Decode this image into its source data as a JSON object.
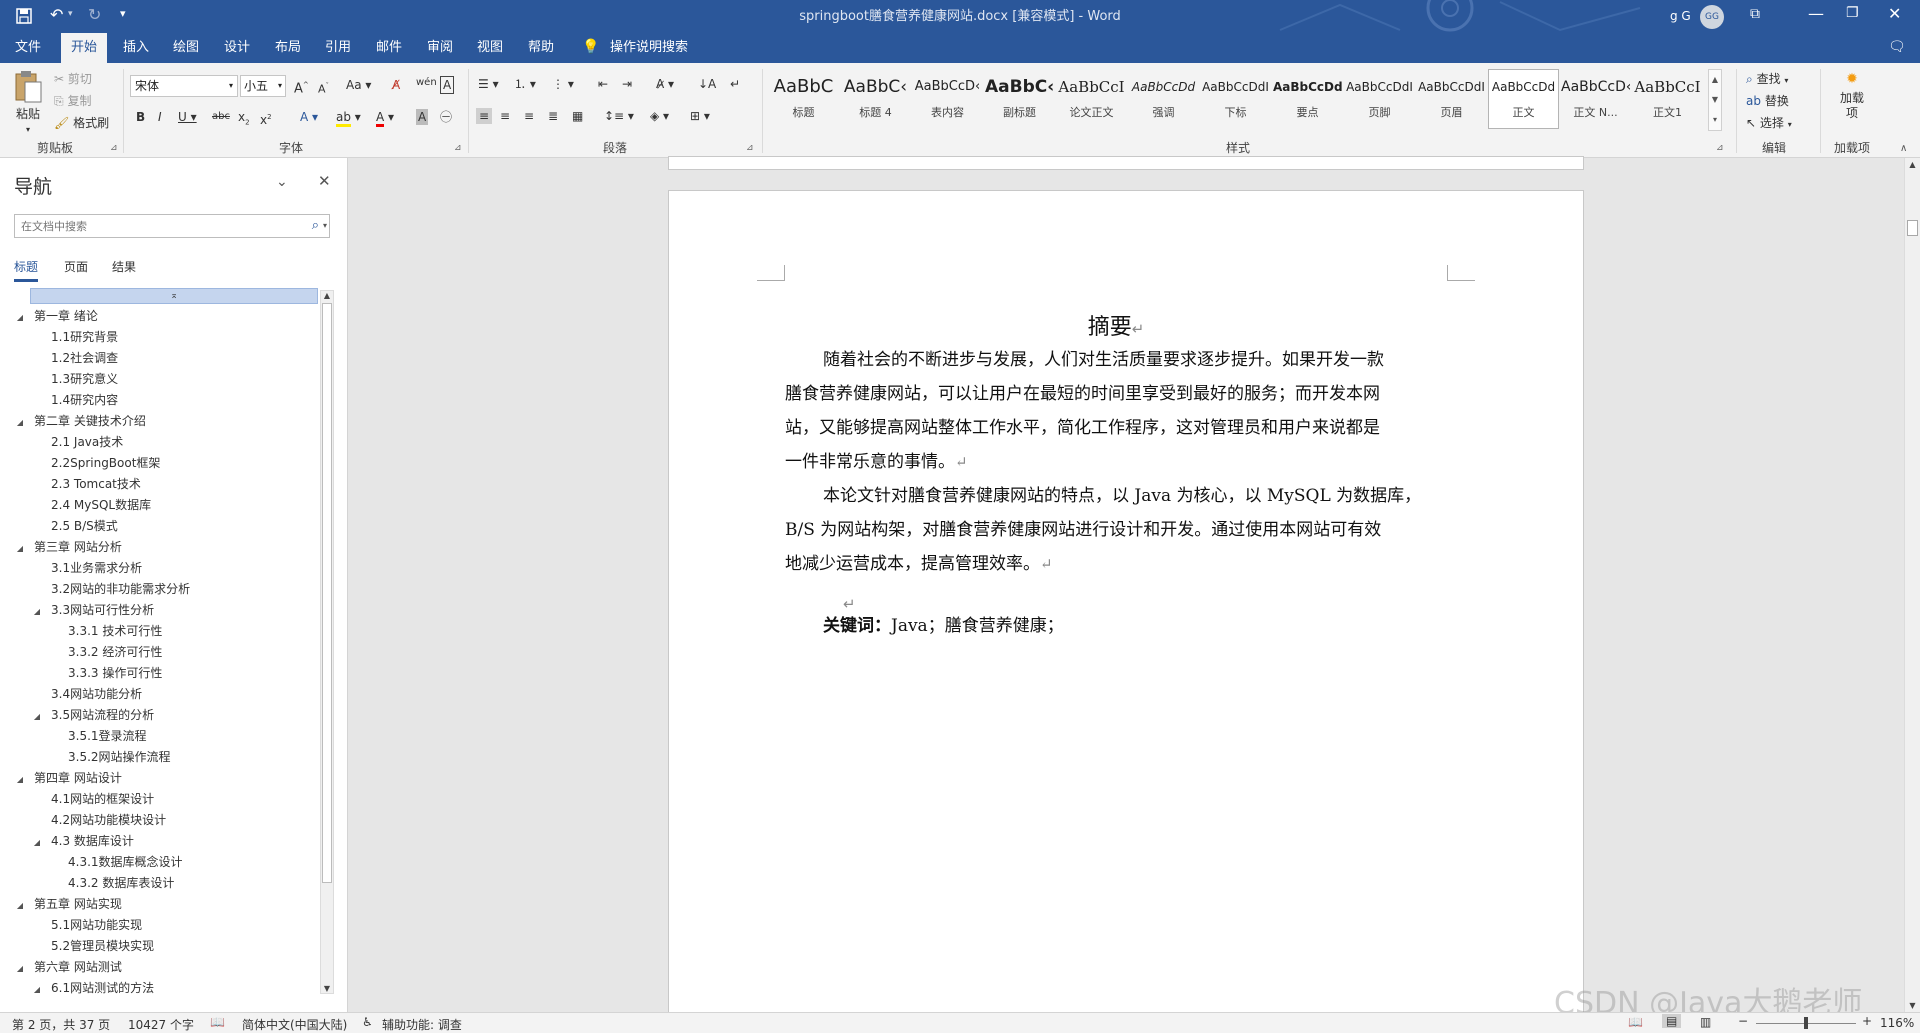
{
  "titlebar": {
    "title": "springboot膳食营养健康网站.docx [兼容模式] - Word",
    "user_name": "g G",
    "avatar_initials": "GG",
    "bg_color": "#2b579a"
  },
  "tabs": {
    "items": [
      "文件",
      "开始",
      "插入",
      "绘图",
      "设计",
      "布局",
      "引用",
      "邮件",
      "审阅",
      "视图",
      "帮助"
    ],
    "active": "开始",
    "tell_me": "操作说明搜索"
  },
  "ribbon": {
    "clipboard": {
      "paste": "粘贴",
      "cut": "剪切",
      "copy": "复制",
      "format_painter": "格式刷",
      "label": "剪贴板"
    },
    "font": {
      "name": "宋体",
      "size": "小五",
      "label": "字体"
    },
    "paragraph": {
      "label": "段落"
    },
    "styles": {
      "label": "样式",
      "items": [
        {
          "sample": "AaBbC",
          "name": "标题"
        },
        {
          "sample": "AaBbC‹",
          "name": "标题 4"
        },
        {
          "sample": "AaBbCcD‹",
          "name": "表内容"
        },
        {
          "sample": "AaBbC‹",
          "name": "副标题"
        },
        {
          "sample": "AaBbCcI",
          "name": "论文正文"
        },
        {
          "sample": "AaBbCcDd",
          "name": "强调"
        },
        {
          "sample": "AaBbCcDdI",
          "name": "下标"
        },
        {
          "sample": "AaBbCcDd",
          "name": "要点"
        },
        {
          "sample": "AaBbCcDdI",
          "name": "页脚"
        },
        {
          "sample": "AaBbCcDdI",
          "name": "页眉"
        },
        {
          "sample": "AaBbCcDd",
          "name": "正文"
        },
        {
          "sample": "AaBbCcD‹",
          "name": "正文 N..."
        },
        {
          "sample": "AaBbCcI",
          "name": "正文1"
        }
      ],
      "selected": "正文"
    },
    "editing": {
      "find": "查找",
      "replace": "替换",
      "select": "选择",
      "label": "编辑"
    },
    "addins": {
      "button": "加载项",
      "label": "加载项"
    }
  },
  "nav": {
    "title": "导航",
    "search_placeholder": "在文档中搜索",
    "tabs": [
      "标题",
      "页面",
      "结果"
    ],
    "active_tab": "标题",
    "items": [
      {
        "text": "第一章 绪论",
        "level": 1,
        "caret": true
      },
      {
        "text": "1.1研究背景",
        "level": 2,
        "caret": false
      },
      {
        "text": "1.2社会调查",
        "level": 2,
        "caret": false
      },
      {
        "text": "1.3研究意义",
        "level": 2,
        "caret": false
      },
      {
        "text": "1.4研究内容",
        "level": 2,
        "caret": false
      },
      {
        "text": "第二章 关键技术介绍",
        "level": 1,
        "caret": true
      },
      {
        "text": "2.1 Java技术",
        "level": 2,
        "caret": false
      },
      {
        "text": "2.2SpringBoot框架",
        "level": 2,
        "caret": false
      },
      {
        "text": "2.3 Tomcat技术",
        "level": 2,
        "caret": false
      },
      {
        "text": "2.4 MySQL数据库",
        "level": 2,
        "caret": false
      },
      {
        "text": "2.5 B/S模式",
        "level": 2,
        "caret": false
      },
      {
        "text": "第三章 网站分析",
        "level": 1,
        "caret": true
      },
      {
        "text": "3.1业务需求分析",
        "level": 2,
        "caret": false
      },
      {
        "text": "3.2网站的非功能需求分析",
        "level": 2,
        "caret": false
      },
      {
        "text": "3.3网站可行性分析",
        "level": 2,
        "caret": true
      },
      {
        "text": "3.3.1 技术可行性",
        "level": 3,
        "caret": false
      },
      {
        "text": "3.3.2 经济可行性",
        "level": 3,
        "caret": false
      },
      {
        "text": "3.3.3 操作可行性",
        "level": 3,
        "caret": false
      },
      {
        "text": "3.4网站功能分析",
        "level": 2,
        "caret": false
      },
      {
        "text": "3.5网站流程的分析",
        "level": 2,
        "caret": true
      },
      {
        "text": "3.5.1登录流程",
        "level": 3,
        "caret": false
      },
      {
        "text": "3.5.2网站操作流程",
        "level": 3,
        "caret": false
      },
      {
        "text": "第四章 网站设计",
        "level": 1,
        "caret": true
      },
      {
        "text": "4.1网站的框架设计",
        "level": 2,
        "caret": false
      },
      {
        "text": "4.2网站功能模块设计",
        "level": 2,
        "caret": false
      },
      {
        "text": "4.3 数据库设计",
        "level": 2,
        "caret": true
      },
      {
        "text": "4.3.1数据库概念设计",
        "level": 3,
        "caret": false
      },
      {
        "text": "4.3.2 数据库表设计",
        "level": 3,
        "caret": false
      },
      {
        "text": "第五章 网站实现",
        "level": 1,
        "caret": true
      },
      {
        "text": "5.1网站功能实现",
        "level": 2,
        "caret": false
      },
      {
        "text": "5.2管理员模块实现",
        "level": 2,
        "caret": false
      },
      {
        "text": "第六章 网站测试",
        "level": 1,
        "caret": true
      },
      {
        "text": "6.1网站测试的方法",
        "level": 2,
        "caret": true
      }
    ]
  },
  "document": {
    "heading": "摘要",
    "para1_lines": [
      "随着社会的不断进步与发展，人们对生活质量要求逐步提升。如果开发一款",
      "膳食营养健康网站，可以让用户在最短的时间里享受到最好的服务；而开发本网",
      "站，又能够提高网站整体工作水平，简化工作程序，这对管理员和用户来说都是",
      "一件非常乐意的事情。"
    ],
    "para2_lines": [
      "本论文针对膳食营养健康网站的特点，以 Java 为核心，以 MySQL 为数据库，",
      "B/S 为网站构架，对膳食营养健康网站进行设计和开发。通过使用本网站可有效",
      "地减少运营成本，提高管理效率。"
    ],
    "keywords_label": "关键词：",
    "keywords_value": "Java；膳食营养健康；",
    "para_mark": "↵",
    "watermark": "CSDN @Java大鹅老师"
  },
  "status": {
    "page": "第 2 页，共 37 页",
    "words": "10427 个字",
    "language": "简体中文(中国大陆)",
    "accessibility": "辅助功能: 调查",
    "zoom": "116%"
  }
}
